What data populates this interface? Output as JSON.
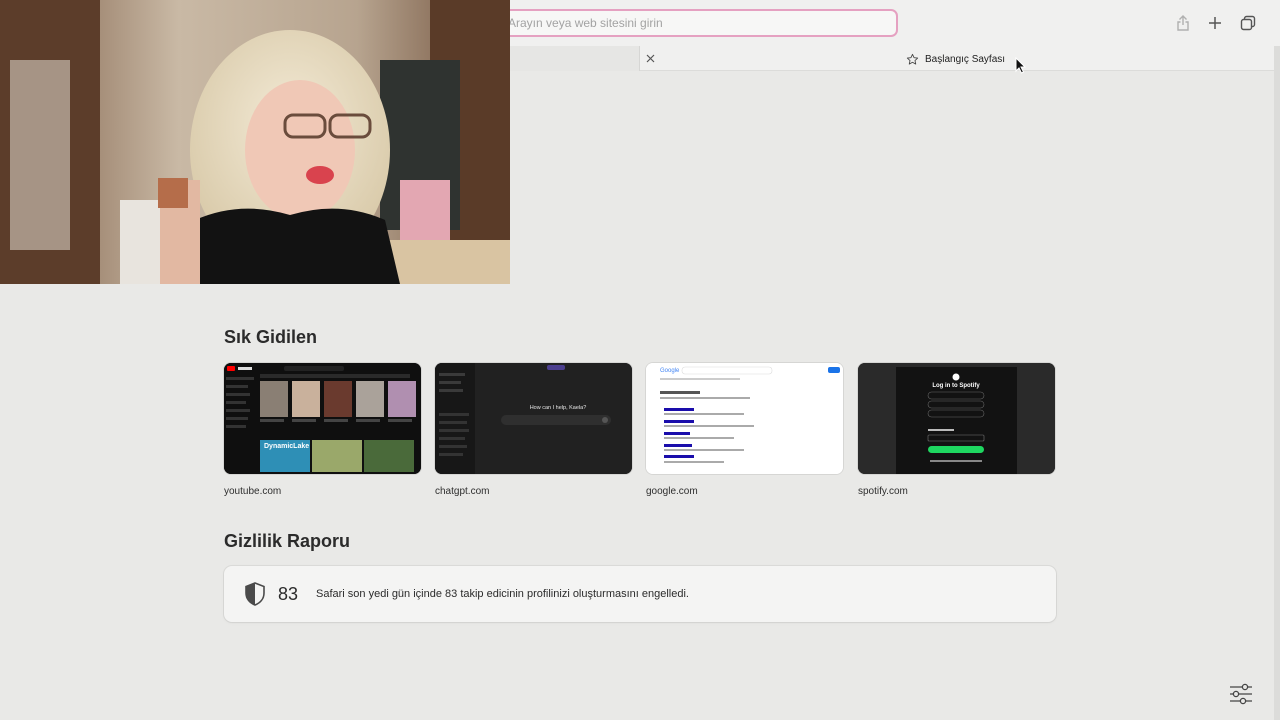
{
  "toolbar": {
    "address_placeholder": "Arayın veya web sitesini girin"
  },
  "tabs": [
    {
      "label": "Başlangıç Sayfası",
      "active": true
    }
  ],
  "favorites": {
    "title": "Sık Gidilen",
    "items": [
      {
        "label": "youtube.com",
        "theme": "dark"
      },
      {
        "label": "chatgpt.com",
        "theme": "dark"
      },
      {
        "label": "google.com",
        "theme": "light"
      },
      {
        "label": "spotify.com",
        "theme": "dark"
      }
    ],
    "chatgpt_prompt": "How can I help, Kaela?",
    "youtube_banner": "DynamicLake",
    "spotify_heading": "Log in to Spotify",
    "google_logo": "Google"
  },
  "privacy": {
    "title": "Gizlilik Raporu",
    "count": "83",
    "message": "Safari son yedi gün içinde 83 takip edicinin profilinizi oluşturmasını engelledi."
  },
  "colors": {
    "accent_pink": "#e5a1c1",
    "spotify_green": "#1ed760",
    "page_bg": "#e9e9e7"
  }
}
